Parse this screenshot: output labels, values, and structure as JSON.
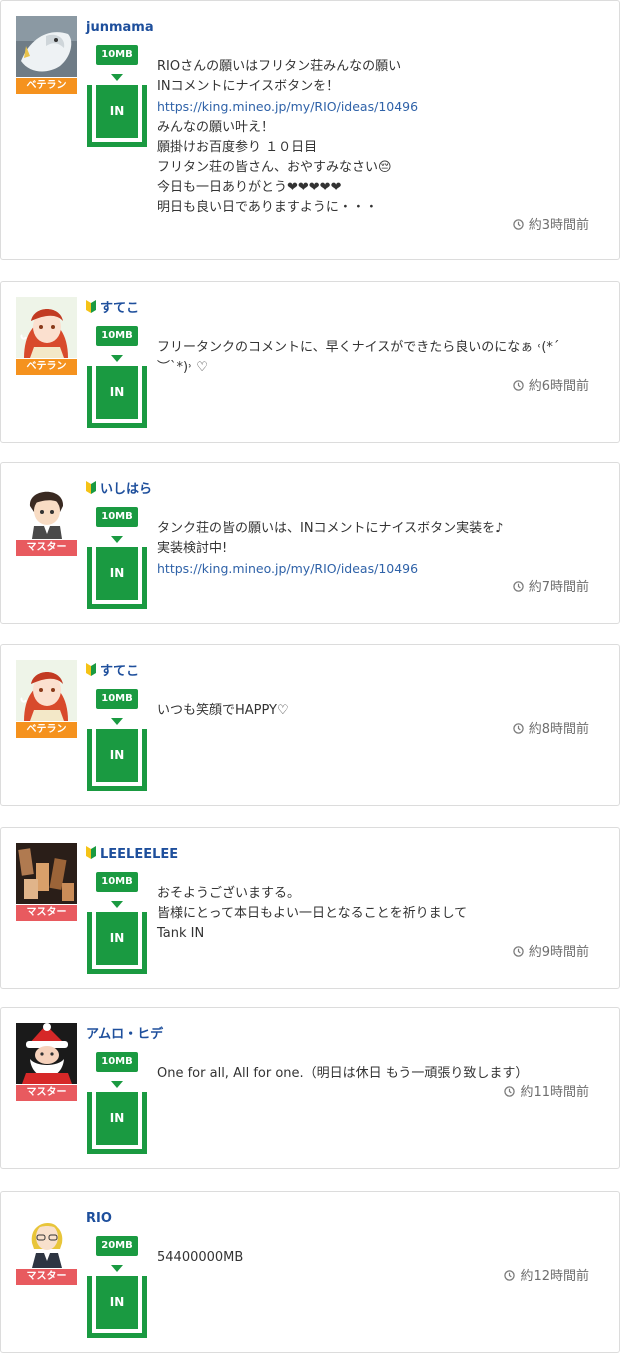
{
  "colors": {
    "accent_green": "#1a9a41",
    "username_blue": "#1e4f9c",
    "link_blue": "#2f62a8",
    "badge_veteran": "#f5921e",
    "badge_master": "#e85a5f"
  },
  "posts": [
    {
      "username": "junmama",
      "beginner_mark": false,
      "avatar_icon": "white-bird-avatar",
      "badge": "ベテラン",
      "mb": "10MB",
      "tank_label": "IN",
      "lines": [
        {
          "text": "RIOさんの願いはフリタン荘みんなの願い",
          "link": false
        },
        {
          "text": "INコメントにナイスボタンを！",
          "link": false
        },
        {
          "text": "https://king.mineo.jp/my/RIO/ideas/10496",
          "link": true
        },
        {
          "text": "みんなの願い叶え！",
          "link": false
        },
        {
          "text": "願掛けお百度参り １０日目",
          "link": false
        },
        {
          "text": "フリタン荘の皆さん、おやすみなさい😔",
          "link": false
        },
        {
          "text": "今日も一日ありがとう❤❤❤❤❤",
          "link": false
        },
        {
          "text": "明日も良い日でありますように・・・",
          "link": false
        }
      ],
      "time": "約3時間前"
    },
    {
      "username": "すてこ",
      "beginner_mark": true,
      "avatar_icon": "red-hair-girl-avatar",
      "badge": "ベテラン",
      "mb": "10MB",
      "tank_label": "IN",
      "lines": [
        {
          "text": "フリータンクのコメントに、早くナイスができたら良いのになぁ ˓(*´",
          "link": false
        },
        {
          "text": "︶`*)˒ ♡",
          "link": false
        }
      ],
      "time": "約6時間前"
    },
    {
      "username": "いしはら",
      "beginner_mark": true,
      "avatar_icon": "boy-avatar",
      "badge": "マスター",
      "mb": "10MB",
      "tank_label": "IN",
      "lines": [
        {
          "text": "タンク荘の皆の願いは、INコメントにナイスボタン実装を♪",
          "link": false
        },
        {
          "text": "実装検討中!",
          "link": false
        },
        {
          "text": "https://king.mineo.jp/my/RIO/ideas/10496",
          "link": true
        }
      ],
      "time": "約7時間前"
    },
    {
      "username": "すてこ",
      "beginner_mark": true,
      "avatar_icon": "red-hair-girl-avatar",
      "badge": "ベテラン",
      "mb": "10MB",
      "tank_label": "IN",
      "lines": [
        {
          "text": "いつも笑顔でHAPPY♡",
          "link": false
        }
      ],
      "time": "約8時間前"
    },
    {
      "username": "LEELEELEE",
      "beginner_mark": true,
      "avatar_icon": "chocolate-bars-avatar",
      "badge": "マスター",
      "mb": "10MB",
      "tank_label": "IN",
      "lines": [
        {
          "text": "おそようございまする。",
          "link": false
        },
        {
          "text": "皆様にとって本日もよい一日となることを祈りまして",
          "link": false
        },
        {
          "text": "Tank IN",
          "link": false
        }
      ],
      "time": "約9時間前"
    },
    {
      "username": "アムロ・ヒデ",
      "beginner_mark": false,
      "avatar_icon": "santa-avatar",
      "badge": "マスター",
      "mb": "10MB",
      "tank_label": "IN",
      "lines": [
        {
          "text": "One for all, All for one.（明日は休日 もう一頑張り致します）",
          "link": false
        }
      ],
      "time": "約11時間前"
    },
    {
      "username": "RIO",
      "beginner_mark": false,
      "avatar_icon": "blonde-woman-avatar",
      "badge": "マスター",
      "mb": "20MB",
      "tank_label": "IN",
      "lines": [
        {
          "text": "54400000MB",
          "link": false
        }
      ],
      "time": "約12時間前"
    }
  ]
}
